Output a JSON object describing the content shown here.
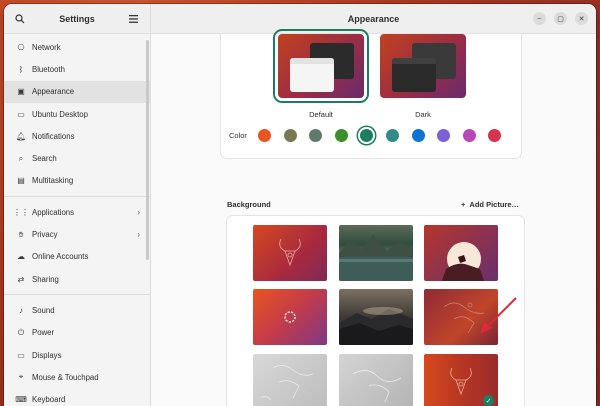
{
  "app": {
    "sidebar_title": "Settings",
    "main_title": "Appearance"
  },
  "sidebar": {
    "items": [
      {
        "label": "Network",
        "icon": "network-icon"
      },
      {
        "label": "Bluetooth",
        "icon": "bluetooth-icon"
      },
      {
        "label": "Appearance",
        "icon": "appearance-icon",
        "active": true
      },
      {
        "label": "Ubuntu Desktop",
        "icon": "ubuntu-desktop-icon"
      },
      {
        "label": "Notifications",
        "icon": "bell-icon"
      },
      {
        "label": "Search",
        "icon": "search-icon"
      },
      {
        "label": "Multitasking",
        "icon": "multitasking-icon"
      },
      {
        "label": "Applications",
        "icon": "grid-icon",
        "chevron": true
      },
      {
        "label": "Privacy",
        "icon": "hand-icon",
        "chevron": true
      },
      {
        "label": "Online Accounts",
        "icon": "cloud-icon"
      },
      {
        "label": "Sharing",
        "icon": "share-icon"
      },
      {
        "label": "Sound",
        "icon": "speaker-icon"
      },
      {
        "label": "Power",
        "icon": "power-icon"
      },
      {
        "label": "Displays",
        "icon": "display-icon"
      },
      {
        "label": "Mouse & Touchpad",
        "icon": "mouse-icon"
      },
      {
        "label": "Keyboard",
        "icon": "keyboard-icon"
      }
    ]
  },
  "style": {
    "themes": [
      {
        "label": "Default",
        "selected": true
      },
      {
        "label": "Dark",
        "selected": false
      }
    ],
    "color_label": "Color",
    "accent_colors": [
      "#e95420",
      "#7a7a52",
      "#5e7a6a",
      "#3d8d2a",
      "#1b7e5e",
      "#338a8a",
      "#0f73d6",
      "#7b61d4",
      "#b847b8",
      "#d6334e"
    ],
    "selected_color_index": 4
  },
  "background": {
    "section_title": "Background",
    "add_picture_label": "Add Picture…",
    "selected_index": 8
  }
}
